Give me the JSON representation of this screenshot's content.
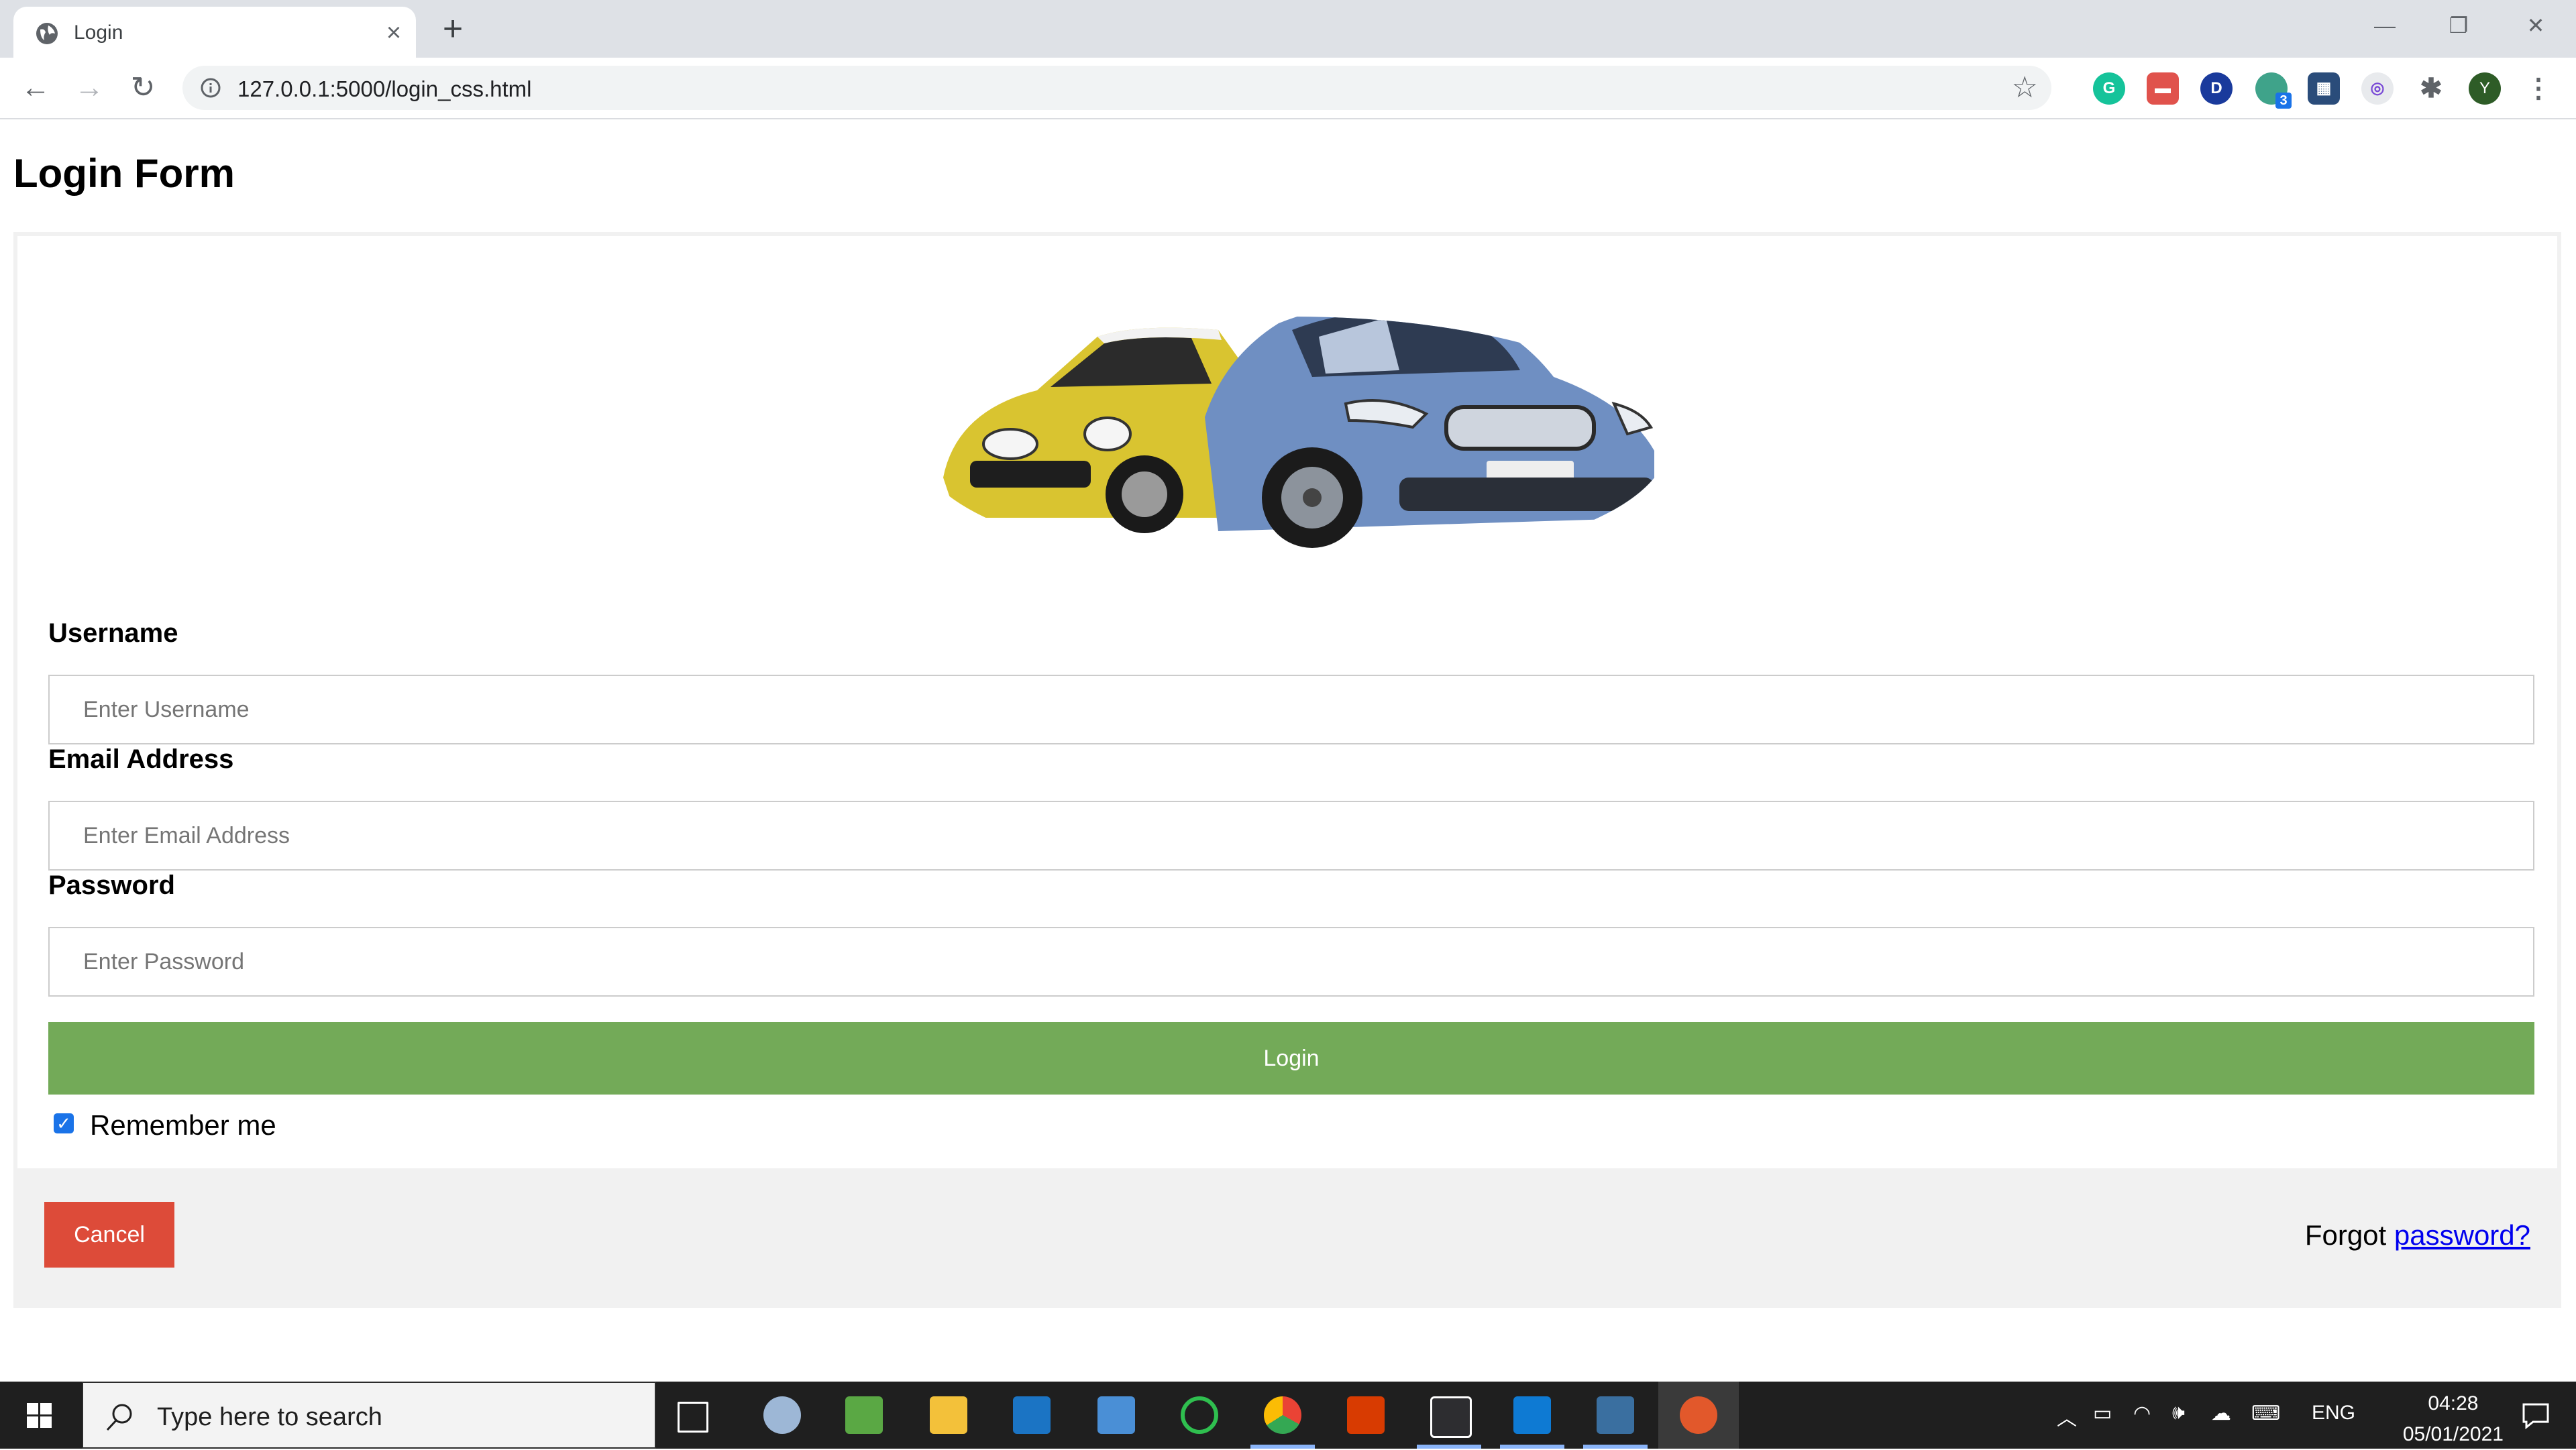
{
  "browser": {
    "tab_title": "Login",
    "url": "127.0.0.1:5000/login_css.html",
    "extensions": [
      "grammarly-icon",
      "reader-icon",
      "dashlane-icon",
      "extension-badge-icon",
      "clapper-icon",
      "owl-icon",
      "puzzle-icon",
      "profile-avatar"
    ],
    "extension_badge": "3",
    "profile_initial": "Y"
  },
  "page": {
    "title": "Login Form",
    "username_label": "Username",
    "username_placeholder": "Enter Username",
    "email_label": "Email Address",
    "email_placeholder": "Enter Email Address",
    "password_label": "Password",
    "password_placeholder": "Enter Password",
    "login_label": "Login",
    "remember_label": "Remember me",
    "remember_checked": true,
    "cancel_label": "Cancel",
    "forgot_text": "Forgot ",
    "forgot_link": "password?",
    "colors": {
      "login_button": "#73aa58",
      "cancel_button": "#dd4b39",
      "footer_bg": "#f1f1f1"
    }
  },
  "taskbar": {
    "search_placeholder": "Type here to search",
    "language": "ENG",
    "time": "04:28",
    "date": "05/01/2021"
  }
}
